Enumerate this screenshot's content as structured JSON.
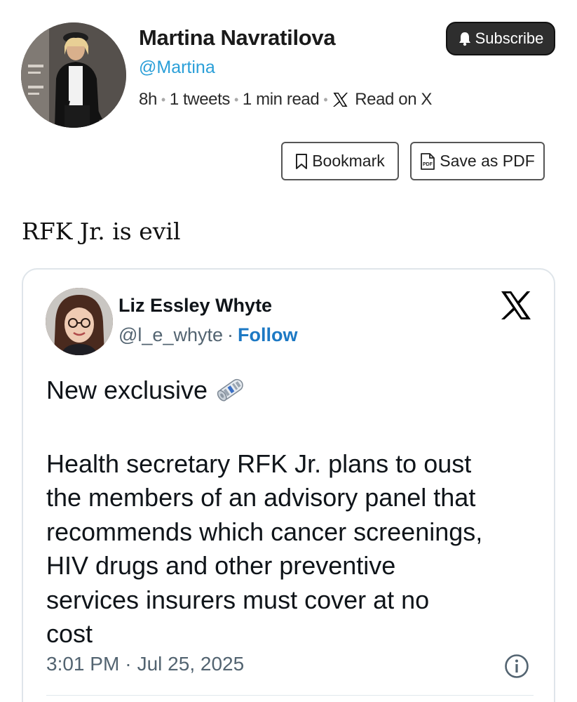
{
  "author": {
    "name": "Martina Navratilova",
    "handle": "@Martina",
    "age": "8h",
    "tweet_count": "1 tweets",
    "read_time": "1 min read",
    "read_on_label": "Read on X",
    "avatar_icon": "author-avatar"
  },
  "actions": {
    "subscribe_label": "Subscribe",
    "bookmark_label": "Bookmark",
    "pdf_label": "Save as PDF",
    "pdf_icon_text": "PDF"
  },
  "post": {
    "text": "RFK Jr. is evil"
  },
  "quoted_tweet": {
    "author_name": "Liz Essley Whyte",
    "author_handle": "@l_e_whyte",
    "separator": "·",
    "follow_label": "Follow",
    "lines": [
      "New exclusive",
      "",
      "Health secretary RFK Jr. plans to oust",
      "the members of an advisory panel that",
      "recommends which cancer screenings,",
      "HIV drugs and other preventive",
      "services insurers must cover at no",
      "cost"
    ],
    "time": "3:01 PM",
    "date": "Jul 25, 2025",
    "emoji_icon": "rolled-newspaper-icon"
  },
  "colors": {
    "link_blue": "#2a9fd8",
    "follow_blue": "#1d79c4",
    "muted_gray": "#536471",
    "subscribe_bg": "#2e2e2e",
    "card_border": "#dfe5ea"
  }
}
